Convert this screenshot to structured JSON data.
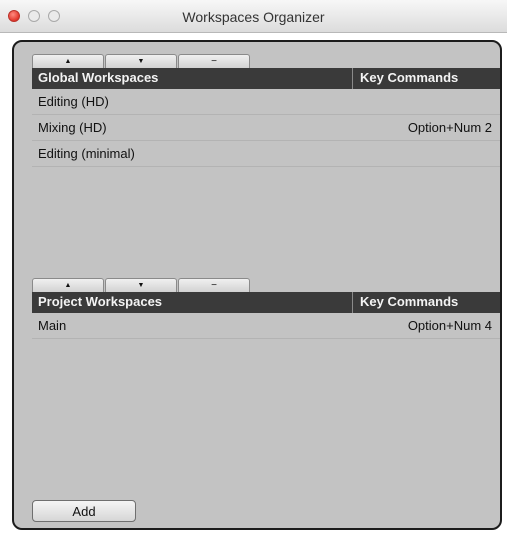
{
  "window": {
    "title": "Workspaces Organizer"
  },
  "global": {
    "toolbar": {
      "up": "▲",
      "down": "▼",
      "remove": "−"
    },
    "header": {
      "name": "Global Workspaces",
      "key": "Key Commands"
    },
    "rows": [
      {
        "name": "Editing (HD)",
        "key": ""
      },
      {
        "name": "Mixing (HD)",
        "key": "Option+Num 2"
      },
      {
        "name": "Editing (minimal)",
        "key": ""
      }
    ]
  },
  "project": {
    "toolbar": {
      "up": "▲",
      "down": "▼",
      "remove": "−"
    },
    "header": {
      "name": "Project Workspaces",
      "key": "Key Commands"
    },
    "rows": [
      {
        "name": "Main",
        "key": "Option+Num 4"
      }
    ]
  },
  "footer": {
    "add_label": "Add"
  },
  "colors": {
    "header_bg": "#3a3a3a",
    "panel_bg": "#c3c3c3",
    "close": "#e2362b"
  }
}
